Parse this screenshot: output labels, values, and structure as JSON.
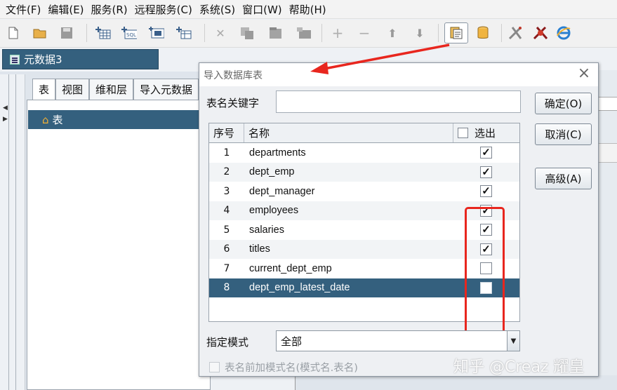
{
  "menu": [
    "文件(F)",
    "编辑(E)",
    "服务(R)",
    "远程服务(C)",
    "系统(S)",
    "窗口(W)",
    "帮助(H)"
  ],
  "toolbar_icons": [
    "new-file-icon",
    "open-folder-icon",
    "save-icon",
    "add-table-icon",
    "add-sql-table-icon",
    "add-field-icon",
    "add-dimension-icon",
    "delete-icon",
    "copy-icon",
    "paste-icon",
    "move-icon",
    "plus-icon",
    "minus-icon",
    "arrow-up-icon",
    "arrow-down-icon",
    "import-db-icon",
    "database-icon",
    "tool-icon",
    "bug-icon",
    "ie-icon"
  ],
  "document": {
    "tab_title": "元数据3",
    "subtabs": [
      "表",
      "视图",
      "维和层",
      "导入元数据"
    ],
    "tree_root": "表"
  },
  "dialog": {
    "title": "导入数据库表",
    "keyword_label": "表名关键字",
    "keyword_value": "",
    "buttons": {
      "ok": "确定(O)",
      "cancel": "取消(C)",
      "advanced": "高级(A)"
    },
    "columns": {
      "num": "序号",
      "name": "名称",
      "select": "选出"
    },
    "rows": [
      {
        "num": "1",
        "name": "departments",
        "checked": true
      },
      {
        "num": "2",
        "name": "dept_emp",
        "checked": true
      },
      {
        "num": "3",
        "name": "dept_manager",
        "checked": true
      },
      {
        "num": "4",
        "name": "employees",
        "checked": true
      },
      {
        "num": "5",
        "name": "salaries",
        "checked": true
      },
      {
        "num": "6",
        "name": "titles",
        "checked": true
      },
      {
        "num": "7",
        "name": "current_dept_emp",
        "checked": false
      },
      {
        "num": "8",
        "name": "dept_emp_latest_date",
        "checked": false
      }
    ],
    "selected_row": "8",
    "mode_label": "指定模式",
    "mode_value": "全部",
    "prefix_label": "表名前加模式名(模式名.表名)",
    "prefix_checked": false
  },
  "watermark": "知乎 @Creaz 耀皇",
  "colors": {
    "selection": "#34607e",
    "annotation": "#e8261e"
  }
}
